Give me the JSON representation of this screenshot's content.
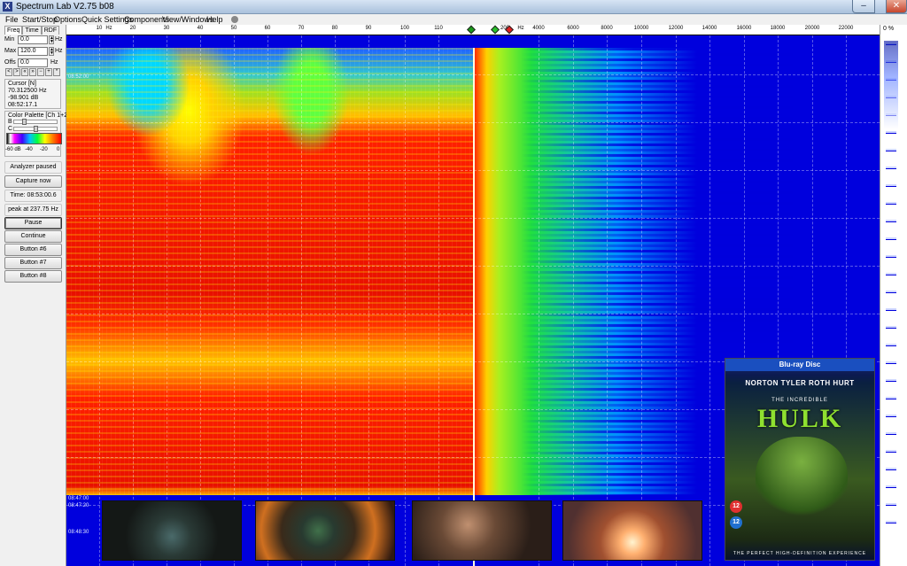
{
  "window": {
    "title": "Spectrum Lab V2.75 b08",
    "icon": "spectrumlab-app-icon",
    "controls": {
      "minimize": "–",
      "maximize": "□",
      "close": "✕"
    }
  },
  "menu": [
    "File",
    "Start/Stop",
    "Options",
    "Quick Settings",
    "Components",
    "View/Windows",
    "Help"
  ],
  "left_panel": {
    "tabs": [
      "Freq",
      "Time",
      "RDF"
    ],
    "min": {
      "label": "Min",
      "value": "0.0",
      "unit": "Hz"
    },
    "max": {
      "label": "Max",
      "value": "120.0",
      "unit": "Hz"
    },
    "offs": {
      "label": "Offs",
      "value": "0.0",
      "unit": "Hz"
    },
    "nav_buttons": [
      "<",
      ">",
      "«",
      "»",
      "−",
      "+",
      "*",
      "/"
    ],
    "cursor": {
      "header": "Cursor [N]",
      "frequency": "70.312500 Hz",
      "level": "-98.901 dB",
      "time": "08:52:17.1"
    },
    "color_palette": {
      "header": "Color Palette [Ch 1+2]",
      "b_label": "B",
      "c_label": "C",
      "scale": [
        "-60 dB",
        "-40",
        "-20",
        "0"
      ],
      "b_level": 0.2,
      "c_level": 0.5
    },
    "info": [
      "Analyzer paused",
      "Capture now",
      "Time:  08:53:00.6",
      "peak at 237.75 Hz"
    ],
    "buttons": [
      "Pause",
      "Continue",
      "Button #6",
      "Button #7",
      "Button #8"
    ]
  },
  "frequency_scale": {
    "left_label": "Hz",
    "left_ticks": [
      "10",
      "20",
      "30",
      "40",
      "50",
      "60",
      "70",
      "80",
      "90",
      "100",
      "110"
    ],
    "right_ticks": [
      "200",
      "Hz",
      "4000",
      "6000",
      "8000",
      "10000",
      "12000",
      "14000",
      "16000",
      "18000",
      "20000",
      "22000"
    ],
    "marker_colors": [
      "#1a9a1a",
      "#2ac02a",
      "#e02020"
    ]
  },
  "waterfall": {
    "time_labels": [
      "08:52:00",
      "08:47:00",
      "08:47:20",
      "08:48:30"
    ],
    "colors": {
      "background": "#0000dd",
      "hot": "#e81000",
      "warm": "#ffc000",
      "cool": "#20e040"
    }
  },
  "thumbnails": [
    {
      "name": "scene-hand-cage"
    },
    {
      "name": "scene-hulk-fire"
    },
    {
      "name": "scene-close-up"
    },
    {
      "name": "scene-explosion"
    }
  ],
  "bluray_cover": {
    "brand": "Blu-ray Disc",
    "cast": "NORTON  TYLER  ROTH  HURT",
    "tagline": "THE INCREDIBLE",
    "title": "HULK",
    "rating1": "12",
    "rating2": "12",
    "footer": "THE PERFECT HIGH-DEFINITION EXPERIENCE"
  },
  "right_panel": {
    "label": "0 %"
  }
}
